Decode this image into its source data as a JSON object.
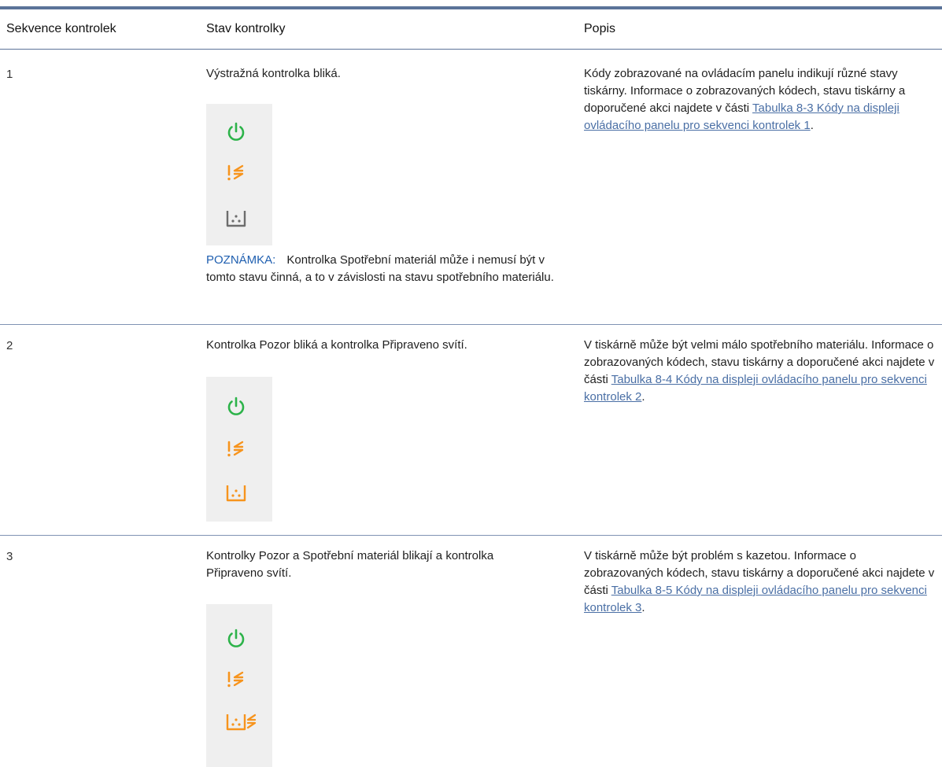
{
  "table": {
    "headers": [
      "Sekvence kontrolek",
      "Stav kontrolky",
      "Popis"
    ],
    "rows": [
      {
        "number": "1",
        "state": "Výstražná kontrolka bliká.",
        "note_label": "POZNÁMKA:",
        "note_text": "Kontrolka Spotřební materiál může i nemusí být v tomto stavu činná, a to v závislosti na stavu spotřebního materiálu.",
        "desc_before": "Kódy zobrazované na ovládacím panelu indikují různé stavy tiskárny. Informace o zobrazovaných kódech, stavu tiskárny a doporučené akci najdete v části ",
        "desc_link": "Tabulka 8-3 Kódy na displeji ovládacího panelu pro sekvenci kontrolek 1",
        "desc_after": "."
      },
      {
        "number": "2",
        "state": "Kontrolka Pozor bliká a kontrolka Připraveno svítí.",
        "desc_before": "V tiskárně může být velmi málo spotřebního materiálu. Informace o zobrazovaných kódech, stavu tiskárny a doporučené akci najdete v části ",
        "desc_link": "Tabulka 8-4 Kódy na displeji ovládacího panelu pro sekvenci kontrolek 2",
        "desc_after": "."
      },
      {
        "number": "3",
        "state": "Kontrolky Pozor a Spotřební materiál blikají a kontrolka Připraveno svítí.",
        "desc_before": "V tiskárně může být problém s kazetou. Informace o zobrazovaných kódech, stavu tiskárny a doporučené akci najdete v části ",
        "desc_link": "Tabulka 8-5 Kódy na displeji ovládacího panelu pro sekvenci kontrolek 3",
        "desc_after": "."
      }
    ]
  },
  "icons": [
    "power-icon",
    "attention-icon",
    "supplies-icon"
  ],
  "colors": {
    "power_green": "#2db34a",
    "attention_orange": "#f7941d",
    "supplies_gray": "#6d6d6d",
    "note_blue": "#1f5fb0",
    "link_blue": "#4a6fa5",
    "rule_blue": "#5b7399"
  }
}
